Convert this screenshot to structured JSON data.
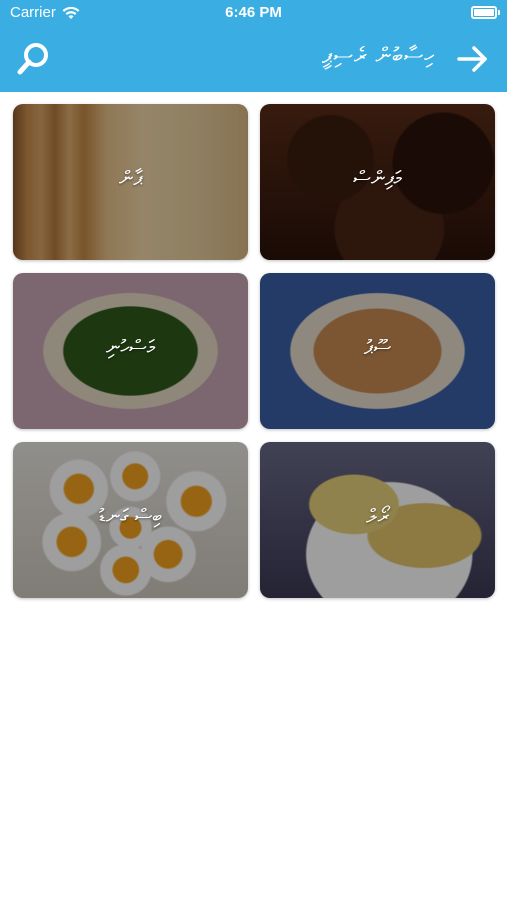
{
  "status_bar": {
    "carrier": "Carrier",
    "time": "6:46 PM",
    "battery_level": 1.0
  },
  "nav": {
    "title": "ހިސާބުން ރެސިޕީ",
    "search_icon": "search-icon",
    "back_icon": "arrow-right-icon",
    "background_color": "#3aaee2"
  },
  "recipes": [
    {
      "label": "ޕާން"
    },
    {
      "label": "މަފިންސް"
    },
    {
      "label": "މަސްހުނި"
    },
    {
      "label": "ސޫޕު"
    },
    {
      "label": "ބިސް ގަނޑު"
    },
    {
      "label": "ރޯލް"
    }
  ]
}
